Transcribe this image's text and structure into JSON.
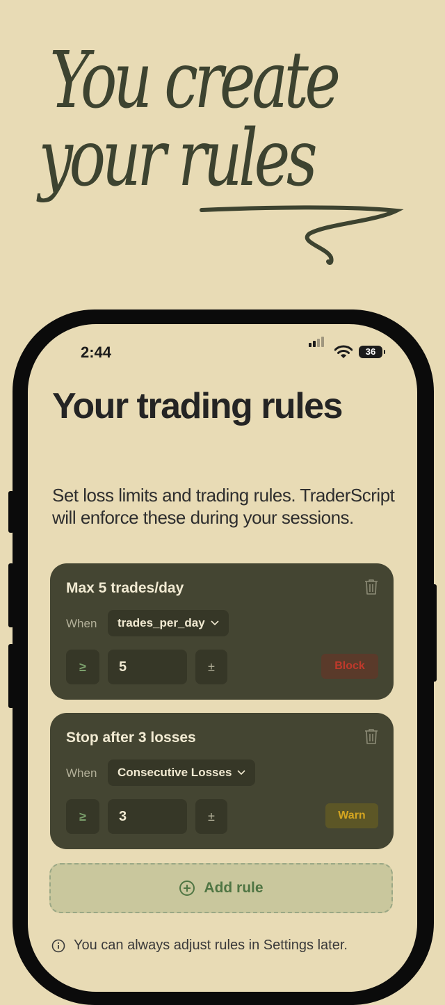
{
  "headline": {
    "line1": "You create",
    "line2": "your rules"
  },
  "status_bar": {
    "time": "2:44",
    "battery": "36"
  },
  "page": {
    "title": "Your trading rules",
    "subtitle": "Set loss limits and trading rules. TraderScript will enforce these during your sessions."
  },
  "rules": [
    {
      "title": "Max 5 trades/day",
      "when_label": "When",
      "variable": "trades_per_day",
      "operator": "≥",
      "value": "5",
      "adjust": "±",
      "action": "Block",
      "action_color": "#c0392b"
    },
    {
      "title": "Stop after 3 losses",
      "when_label": "When",
      "variable": "Consecutive Losses",
      "operator": "≥",
      "value": "3",
      "adjust": "±",
      "action": "Warn",
      "action_color": "#d4a520"
    }
  ],
  "add_rule": {
    "label": "Add rule"
  },
  "footnote": "You can always adjust rules in Settings later.",
  "colors": {
    "background": "#e8dbb5",
    "card": "#444532",
    "accent": "#4f7543",
    "block_badge": "#5a3a2a",
    "warn_badge": "#5c5626"
  },
  "icons": {
    "trash": "trash-icon",
    "chevron": "chevron-down-icon",
    "plus": "plus-circle-icon",
    "info": "info-icon",
    "signal": "signal-icon",
    "wifi": "wifi-icon"
  }
}
